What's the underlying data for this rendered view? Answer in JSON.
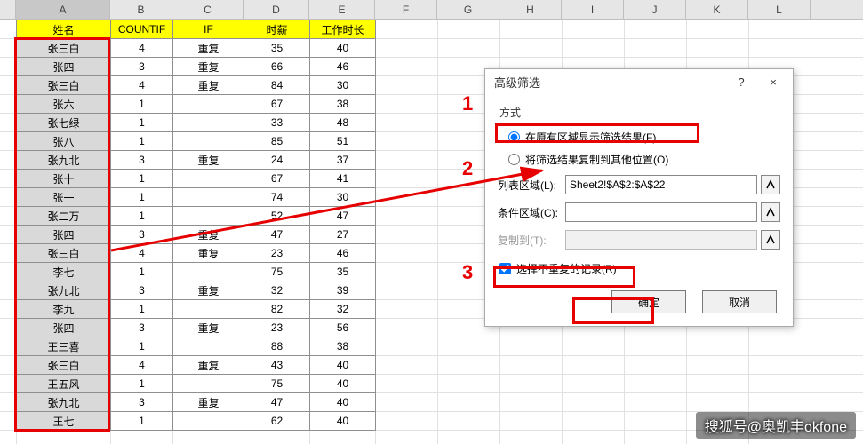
{
  "columns": [
    "A",
    "B",
    "C",
    "D",
    "E",
    "F",
    "G",
    "H",
    "I",
    "J",
    "K",
    "L"
  ],
  "headers": {
    "A": "姓名",
    "B": "COUNTIF",
    "C": "IF",
    "D": "时薪",
    "E": "工作时长"
  },
  "rows": [
    {
      "name": "张三白",
      "countif": 4,
      "if": "重复",
      "rate": 35,
      "hours": 40
    },
    {
      "name": "张四",
      "countif": 3,
      "if": "重复",
      "rate": 66,
      "hours": 46
    },
    {
      "name": "张三白",
      "countif": 4,
      "if": "重复",
      "rate": 84,
      "hours": 30
    },
    {
      "name": "张六",
      "countif": 1,
      "if": "",
      "rate": 67,
      "hours": 38
    },
    {
      "name": "张七绿",
      "countif": 1,
      "if": "",
      "rate": 33,
      "hours": 48
    },
    {
      "name": "张八",
      "countif": 1,
      "if": "",
      "rate": 85,
      "hours": 51
    },
    {
      "name": "张九北",
      "countif": 3,
      "if": "重复",
      "rate": 24,
      "hours": 37
    },
    {
      "name": "张十",
      "countif": 1,
      "if": "",
      "rate": 67,
      "hours": 41
    },
    {
      "name": "张一",
      "countif": 1,
      "if": "",
      "rate": 74,
      "hours": 30
    },
    {
      "name": "张二万",
      "countif": 1,
      "if": "",
      "rate": 52,
      "hours": 47
    },
    {
      "name": "张四",
      "countif": 3,
      "if": "重复",
      "rate": 47,
      "hours": 27
    },
    {
      "name": "张三白",
      "countif": 4,
      "if": "重复",
      "rate": 23,
      "hours": 46
    },
    {
      "name": "李七",
      "countif": 1,
      "if": "",
      "rate": 75,
      "hours": 35
    },
    {
      "name": "张九北",
      "countif": 3,
      "if": "重复",
      "rate": 32,
      "hours": 39
    },
    {
      "name": "李九",
      "countif": 1,
      "if": "",
      "rate": 82,
      "hours": 32
    },
    {
      "name": "张四",
      "countif": 3,
      "if": "重复",
      "rate": 23,
      "hours": 56
    },
    {
      "name": "王三喜",
      "countif": 1,
      "if": "",
      "rate": 88,
      "hours": 38
    },
    {
      "name": "张三白",
      "countif": 4,
      "if": "重复",
      "rate": 43,
      "hours": 40
    },
    {
      "name": "王五风",
      "countif": 1,
      "if": "",
      "rate": 75,
      "hours": 40
    },
    {
      "name": "张九北",
      "countif": 3,
      "if": "重复",
      "rate": 47,
      "hours": 40
    },
    {
      "name": "王七",
      "countif": 1,
      "if": "",
      "rate": 62,
      "hours": 40
    }
  ],
  "dialog": {
    "title": "高级筛选",
    "help_icon": "?",
    "close_icon": "×",
    "group": "方式",
    "radio1": "在原有区域显示筛选结果(F)",
    "radio2": "将筛选结果复制到其他位置(O)",
    "list_range_lbl": "列表区域(L):",
    "list_range_val": "Sheet2!$A$2:$A$22",
    "criteria_lbl": "条件区域(C):",
    "criteria_val": "",
    "copyto_lbl": "复制到(T):",
    "copyto_val": "",
    "unique_lbl": "选择不重复的记录(R)",
    "ok": "确定",
    "cancel": "取消"
  },
  "annotations": {
    "n1": "1",
    "n2": "2",
    "n3": "3"
  },
  "watermark": "搜狐号@奥凯丰okfone",
  "chart_data": {
    "type": "table",
    "title": "",
    "columns": [
      "姓名",
      "COUNTIF",
      "IF",
      "时薪",
      "工作时长"
    ],
    "rows": [
      [
        "张三白",
        4,
        "重复",
        35,
        40
      ],
      [
        "张四",
        3,
        "重复",
        66,
        46
      ],
      [
        "张三白",
        4,
        "重复",
        84,
        30
      ],
      [
        "张六",
        1,
        "",
        67,
        38
      ],
      [
        "张七绿",
        1,
        "",
        33,
        48
      ],
      [
        "张八",
        1,
        "",
        85,
        51
      ],
      [
        "张九北",
        3,
        "重复",
        24,
        37
      ],
      [
        "张十",
        1,
        "",
        67,
        41
      ],
      [
        "张一",
        1,
        "",
        74,
        30
      ],
      [
        "张二万",
        1,
        "",
        52,
        47
      ],
      [
        "张四",
        3,
        "重复",
        47,
        27
      ],
      [
        "张三白",
        4,
        "重复",
        23,
        46
      ],
      [
        "李七",
        1,
        "",
        75,
        35
      ],
      [
        "张九北",
        3,
        "重复",
        32,
        39
      ],
      [
        "李九",
        1,
        "",
        82,
        32
      ],
      [
        "张四",
        3,
        "重复",
        23,
        56
      ],
      [
        "王三喜",
        1,
        "",
        88,
        38
      ],
      [
        "张三白",
        4,
        "重复",
        43,
        40
      ],
      [
        "王五风",
        1,
        "",
        75,
        40
      ],
      [
        "张九北",
        3,
        "重复",
        47,
        40
      ],
      [
        "王七",
        1,
        "",
        62,
        40
      ]
    ]
  }
}
